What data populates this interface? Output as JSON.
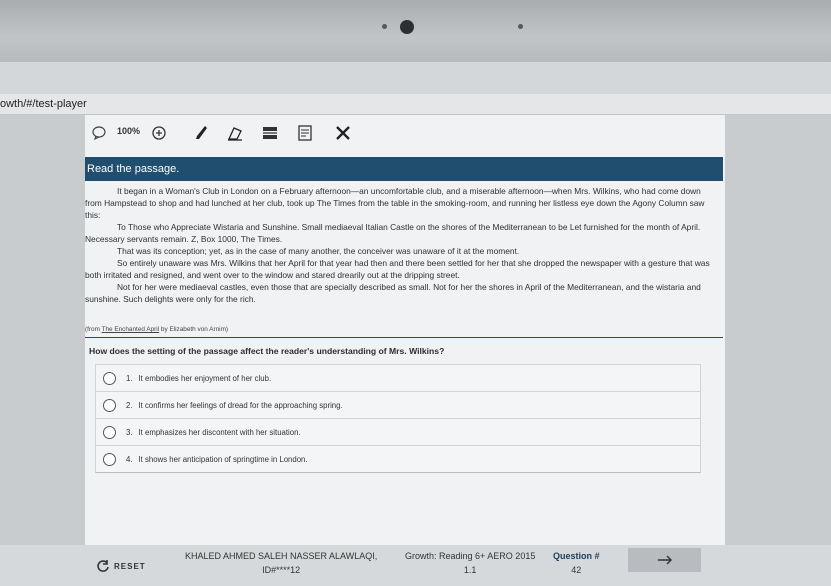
{
  "browser": {
    "url_fragment": "owth/#/test-player"
  },
  "toolbar": {
    "zoom": "100%",
    "icons": [
      "speech-bubble-icon",
      "zoom-in-icon",
      "highlighter-icon",
      "eraser-icon",
      "line-reader-icon",
      "notepad-icon",
      "answer-eliminator-icon"
    ]
  },
  "passage": {
    "heading": "Read the passage.",
    "paragraphs": [
      "It began in a Woman's Club in London on a February afternoon—an uncomfortable club, and a miserable afternoon—when Mrs. Wilkins, who had come down from Hampstead to shop and had lunched at her club, took up The Times from the table in the smoking-room, and running her listless eye down the Agony Column saw this:",
      "To Those who Appreciate Wistaria and Sunshine. Small mediaeval Italian Castle on the shores of the Mediterranean to be Let furnished for the month of April. Necessary servants remain. Z, Box 1000, The Times.",
      "That was its conception; yet, as in the case of many another, the conceiver was unaware of it at the moment.",
      "So entirely unaware was Mrs. Wilkins that her April for that year had then and there been settled for her that she dropped the newspaper with a gesture that was both irritated and resigned, and went over to the window and stared drearily out at the dripping street.",
      "Not for her were mediaeval castles, even those that are specially described as small. Not for her the shores in April of the Mediterranean, and the wistaria and sunshine. Such delights were only for the rich."
    ],
    "source_prefix": "(from ",
    "source_title": "The Enchanted April",
    "source_suffix": " by Elizabeth von Arnim)"
  },
  "question": {
    "text": "How does the setting of the passage affect the reader's understanding of Mrs. Wilkins?",
    "options": [
      {
        "num": "1.",
        "text": "It embodies her enjoyment of her club."
      },
      {
        "num": "2.",
        "text": "It confirms her feelings of dread for the approaching spring."
      },
      {
        "num": "3.",
        "text": "It emphasizes her discontent with her situation."
      },
      {
        "num": "4.",
        "text": "It shows her anticipation of springtime in London."
      }
    ]
  },
  "footer": {
    "reset_label": "RESET",
    "student_name": "KHALED AHMED SALEH NASSER ALAWLAQI,",
    "student_id": "ID#****12",
    "growth_line1": "Growth: Reading 6+ AERO 2015",
    "growth_line2": "1.1",
    "question_label": "Question #",
    "question_number": "42"
  },
  "colors": {
    "header": "#1f4e6e",
    "background": "#f1f2f3"
  }
}
